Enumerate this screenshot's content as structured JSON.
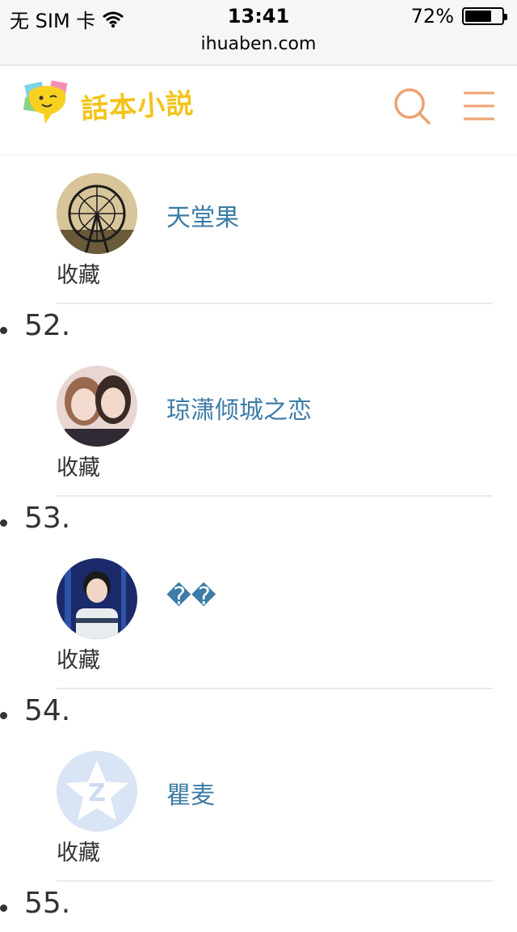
{
  "status": {
    "carrier": "无 SIM 卡",
    "time": "13:41",
    "battery": "72%",
    "battery_level": 0.72,
    "url": "ihuaben.com"
  },
  "header": {
    "logo_text": "話本小説",
    "accent_color": "#eda26e",
    "logo_color": "#f2c419"
  },
  "entries": [
    {
      "number": "",
      "username": "天堂果",
      "fav_label": "收藏"
    },
    {
      "number": "52.",
      "username": "琼潇倾城之恋",
      "fav_label": "收藏"
    },
    {
      "number": "53.",
      "username": "��",
      "fav_label": "收藏"
    },
    {
      "number": "54.",
      "username": "瞿麦",
      "fav_label": "收藏"
    },
    {
      "number": "55.",
      "username": "",
      "fav_label": ""
    }
  ]
}
